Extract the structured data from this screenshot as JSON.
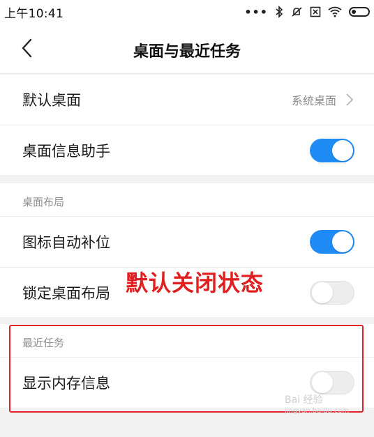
{
  "status_bar": {
    "time": "上午10:41",
    "dots": "•••"
  },
  "header": {
    "title": "桌面与最近任务"
  },
  "group1": {
    "default_desktop": {
      "label": "默认桌面",
      "value": "系统桌面"
    },
    "desktop_info_assistant": {
      "label": "桌面信息助手",
      "enabled": true
    }
  },
  "layout_section": {
    "header": "桌面布局",
    "auto_fill_icons": {
      "label": "图标自动补位",
      "enabled": true
    },
    "lock_layout": {
      "label": "锁定桌面布局",
      "enabled": false
    }
  },
  "recent_section": {
    "header": "最近任务",
    "show_memory_info": {
      "label": "显示内存信息",
      "enabled": false
    }
  },
  "annotation": {
    "text": "默认关闭状态"
  },
  "watermark": {
    "text": "Bai 经验",
    "sub": "jingyan.baidu.com"
  },
  "colors": {
    "accent": "#1f8bf4",
    "annotation": "#e02020"
  }
}
